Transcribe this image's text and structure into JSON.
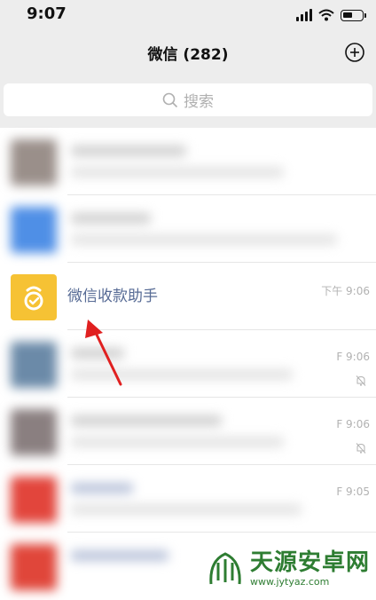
{
  "status_bar": {
    "time": "9:07",
    "battery_level": 0.55
  },
  "header": {
    "title": "微信 (282)",
    "add_icon": "plus-circle-icon"
  },
  "search": {
    "placeholder": "搜索",
    "icon": "search-icon"
  },
  "chats": [
    {
      "name": "",
      "time": "",
      "blurred": true,
      "avatar_color": "#9a8f8a"
    },
    {
      "name": "",
      "time": "",
      "blurred": true,
      "avatar_color": "#4f8fe6"
    },
    {
      "name": "微信收款助手",
      "time": "下午 9:06",
      "blurred": false,
      "avatar_color": "#f6c234"
    },
    {
      "name": "",
      "time": "F 9:06",
      "blurred": true,
      "muted": true,
      "avatar_color": "#6b8aa8"
    },
    {
      "name": "",
      "time": "F 9:06",
      "blurred": true,
      "muted": true,
      "avatar_color": "#8a7f80"
    },
    {
      "name": "",
      "time": "F 9:05",
      "blurred": true,
      "avatar_color": "#e2453c"
    },
    {
      "name": "",
      "time": "",
      "blurred": true,
      "avatar_color": "#e0463a"
    }
  ],
  "watermark": {
    "main": "天源安卓网",
    "sub": "www.jytyaz.com",
    "color": "#2e7d32"
  },
  "annotation": {
    "arrow_color": "#e02020"
  }
}
